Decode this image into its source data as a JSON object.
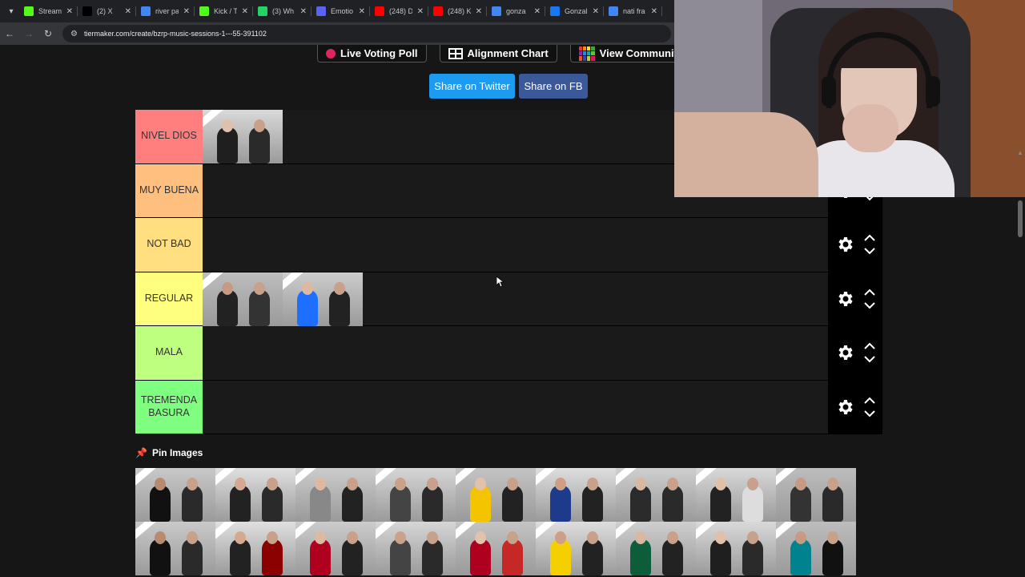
{
  "browser": {
    "tabs": [
      {
        "title": "Stream",
        "color": "#53fc18"
      },
      {
        "title": "(2) X",
        "color": "#000000"
      },
      {
        "title": "river pa",
        "color": "#4285f4"
      },
      {
        "title": "Kick / T",
        "color": "#53fc18"
      },
      {
        "title": "(3) Wh",
        "color": "#25d366"
      },
      {
        "title": "Emotio",
        "color": "#5865f2"
      },
      {
        "title": "(248) D",
        "color": "#ff0000"
      },
      {
        "title": "(248) K",
        "color": "#ff0000"
      },
      {
        "title": "gonza",
        "color": "#4285f4"
      },
      {
        "title": "Gonzal",
        "color": "#1877f2"
      },
      {
        "title": "nati fra",
        "color": "#4285f4"
      }
    ],
    "url": "tiermaker.com/create/bzrp-music-sessions-1---55-391102"
  },
  "top_buttons": {
    "live_voting": "Live Voting Poll",
    "alignment": "Alignment Chart",
    "community": "View Community R"
  },
  "share": {
    "twitter": "Share on Twitter",
    "fb": "Share on FB"
  },
  "tiers": [
    {
      "label": "NIVEL DIOS",
      "color": "#ff7f7f"
    },
    {
      "label": "MUY BUENA",
      "color": "#ffbf7f"
    },
    {
      "label": "NOT BAD",
      "color": "#ffdf7f"
    },
    {
      "label": "REGULAR",
      "color": "#ffff7f"
    },
    {
      "label": "MALA",
      "color": "#bfff7f"
    },
    {
      "label": "TREMENDA BASURA",
      "color": "#7fff7f"
    }
  ],
  "pin_images": {
    "label": "Pin Images"
  }
}
